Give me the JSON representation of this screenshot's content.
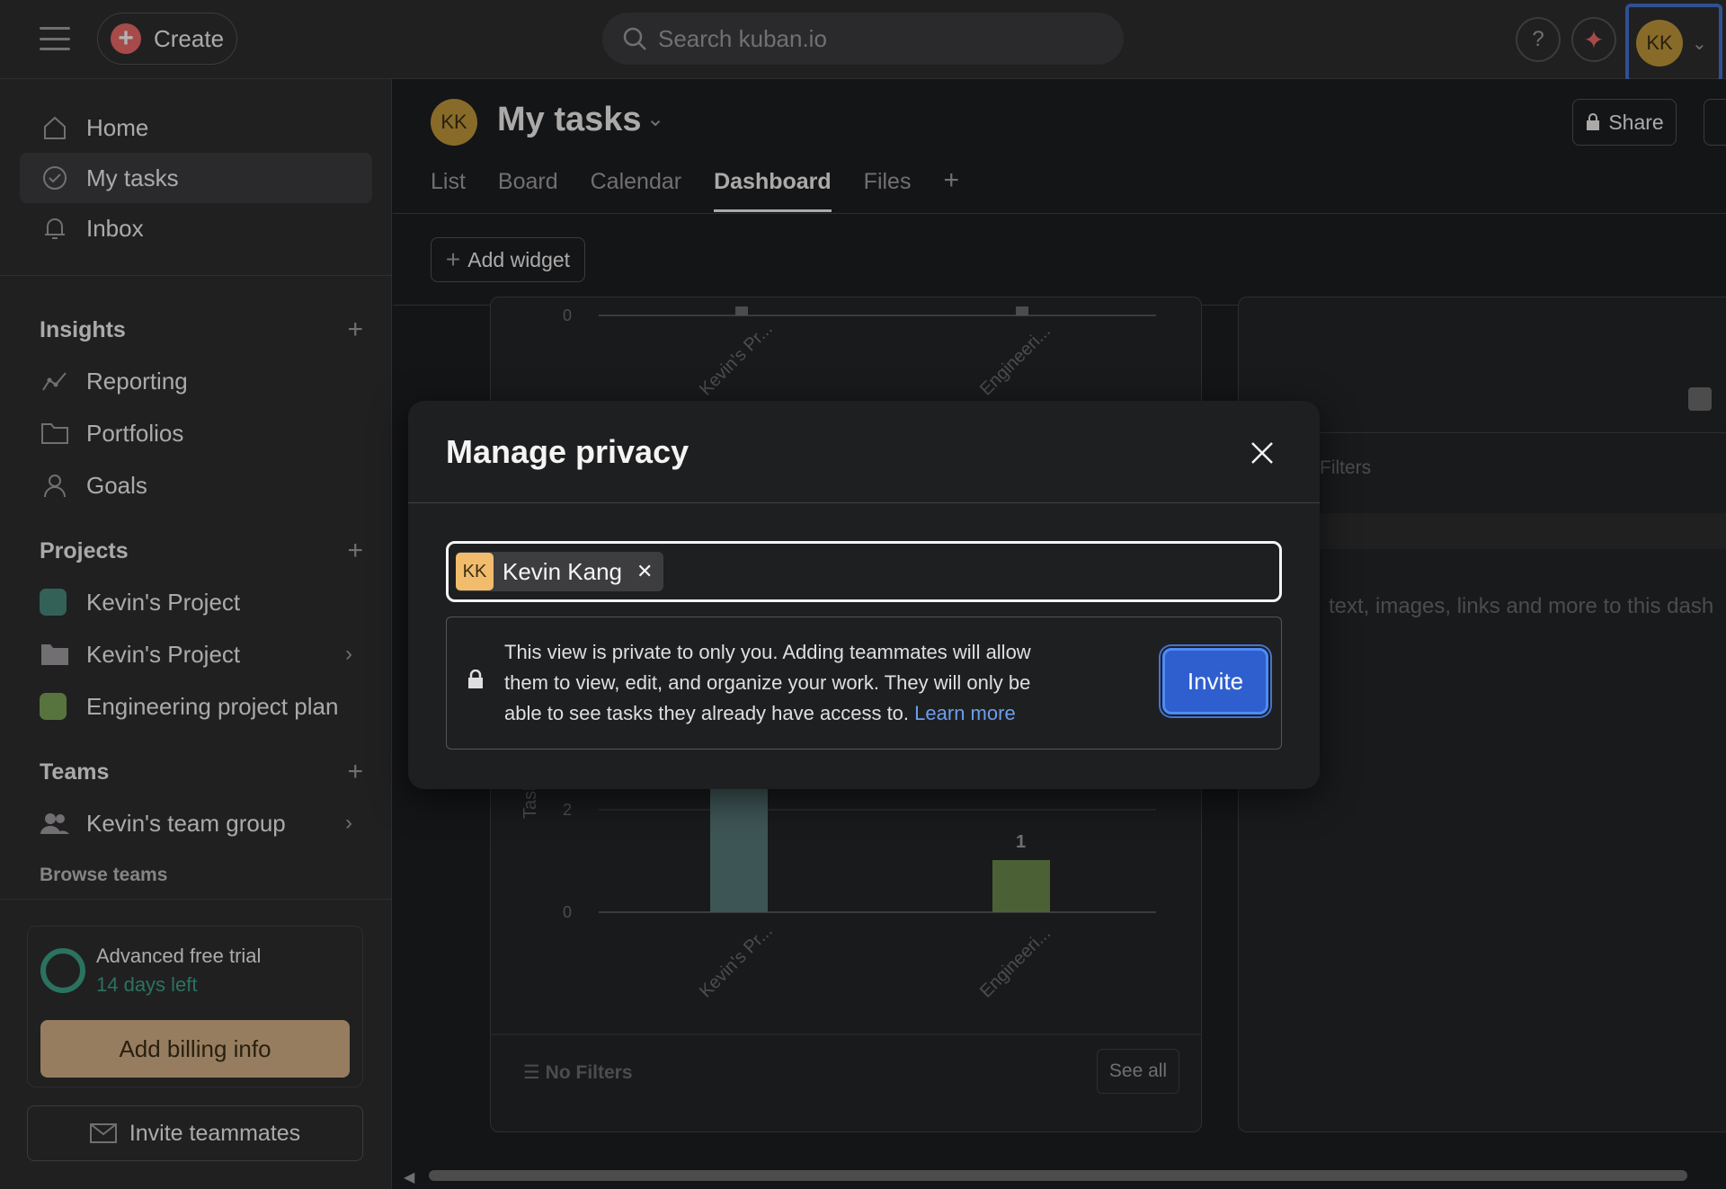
{
  "topbar": {
    "create_label": "Create",
    "search_placeholder": "Search kuban.io",
    "help_label": "?",
    "avatar_initials": "KK"
  },
  "sidebar": {
    "nav": [
      {
        "label": "Home",
        "icon": "home-icon"
      },
      {
        "label": "My tasks",
        "icon": "check-circle-icon",
        "active": true
      },
      {
        "label": "Inbox",
        "icon": "bell-icon"
      }
    ],
    "insights": {
      "title": "Insights",
      "items": [
        {
          "label": "Reporting",
          "icon": "reporting-icon"
        },
        {
          "label": "Portfolios",
          "icon": "folder-icon"
        },
        {
          "label": "Goals",
          "icon": "person-icon"
        }
      ]
    },
    "projects": {
      "title": "Projects",
      "items": [
        {
          "label": "Kevin's Project",
          "color": "#4a8c7e"
        },
        {
          "label": "Kevin's Project",
          "icon": "folder-icon"
        },
        {
          "label": "Engineering project plan",
          "color": "#7fa75a"
        }
      ]
    },
    "teams": {
      "title": "Teams",
      "items": [
        {
          "label": "Kevin's team group",
          "icon": "team-icon"
        }
      ],
      "browse": "Browse teams"
    },
    "trial": {
      "title": "Advanced free trial",
      "subtitle": "14 days left",
      "billing_button": "Add billing info"
    },
    "invite_teammates": "Invite teammates"
  },
  "page": {
    "avatar_initials": "KK",
    "title": "My tasks",
    "tabs": [
      "List",
      "Board",
      "Calendar",
      "Dashboard",
      "Files"
    ],
    "active_tab": "Dashboard",
    "share_label": "Share",
    "add_widget_label": "Add widget"
  },
  "background_chart": {
    "ylabel": "Task (count)",
    "categories": [
      "Kevin's Pr...",
      "Engineeri..."
    ],
    "bar_value_label": "1",
    "tick_labels": [
      "0",
      "2",
      "0"
    ],
    "filters_label": "No Filters",
    "see_all_label": "See all",
    "right_filters_label": "Filters",
    "right_text": "text, images, links and more to this dash"
  },
  "modal": {
    "title": "Manage privacy",
    "chip": {
      "initials": "KK",
      "name": "Kevin Kang"
    },
    "privacy_text": "This view is private to only you. Adding teammates will allow them to view, edit, and organize your work. They will only be able to see tasks they already have access to.",
    "learn_more": "Learn more",
    "invite_label": "Invite"
  },
  "colors": {
    "accent": "#4573d2",
    "create": "#f06a6a",
    "avatar": "#c49a3c",
    "chip_avatar": "#f1bd6c",
    "bar1": "#5a7a7a",
    "bar2": "#6e8a4e"
  }
}
